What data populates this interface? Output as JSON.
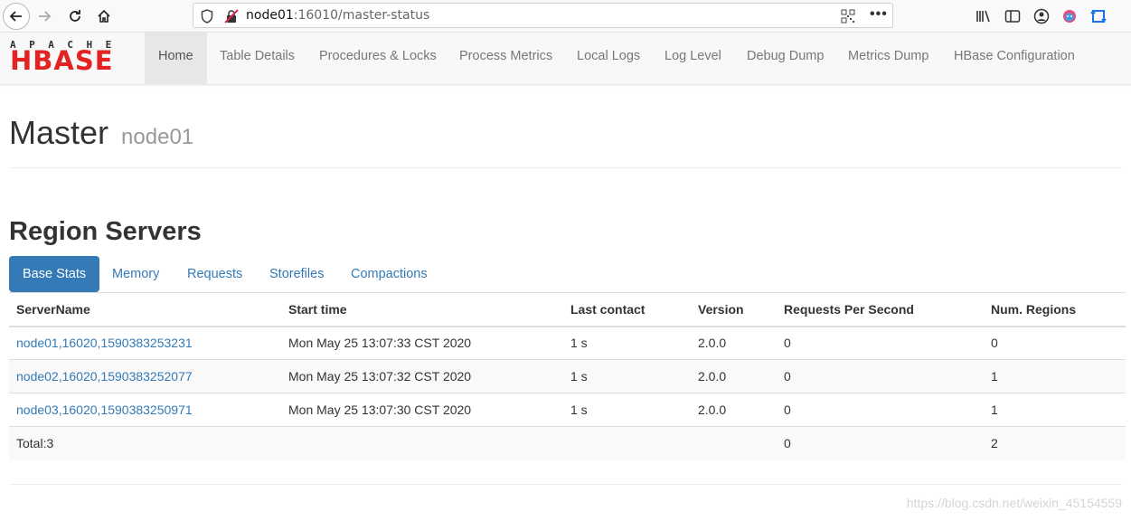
{
  "browser": {
    "url_host": "node01",
    "url_rest": ":16010/master-status"
  },
  "navbar": {
    "logo_top": "APACHE",
    "logo_main": "HBASE",
    "items": [
      {
        "label": "Home"
      },
      {
        "label": "Table Details"
      },
      {
        "label": "Procedures & Locks"
      },
      {
        "label": "Process Metrics"
      },
      {
        "label": "Local Logs"
      },
      {
        "label": "Log Level"
      },
      {
        "label": "Debug Dump"
      },
      {
        "label": "Metrics Dump"
      },
      {
        "label": "HBase Configuration"
      }
    ]
  },
  "header": {
    "title": "Master",
    "subtitle": "node01"
  },
  "region_servers": {
    "title": "Region Servers",
    "tabs": [
      {
        "label": "Base Stats"
      },
      {
        "label": "Memory"
      },
      {
        "label": "Requests"
      },
      {
        "label": "Storefiles"
      },
      {
        "label": "Compactions"
      }
    ],
    "columns": [
      "ServerName",
      "Start time",
      "Last contact",
      "Version",
      "Requests Per Second",
      "Num. Regions"
    ],
    "rows": [
      [
        "node01,16020,1590383253231",
        "Mon May 25 13:07:33 CST 2020",
        "1 s",
        "2.0.0",
        "0",
        "0"
      ],
      [
        "node02,16020,1590383252077",
        "Mon May 25 13:07:32 CST 2020",
        "1 s",
        "2.0.0",
        "0",
        "1"
      ],
      [
        "node03,16020,1590383250971",
        "Mon May 25 13:07:30 CST 2020",
        "1 s",
        "2.0.0",
        "0",
        "1"
      ]
    ],
    "total": [
      "Total:3",
      "",
      "",
      "",
      "0",
      "2"
    ]
  },
  "watermark": "https://blog.csdn.net/weixin_45154559",
  "colors": {
    "link": "#337ab7",
    "logo_red": "#e32222"
  }
}
